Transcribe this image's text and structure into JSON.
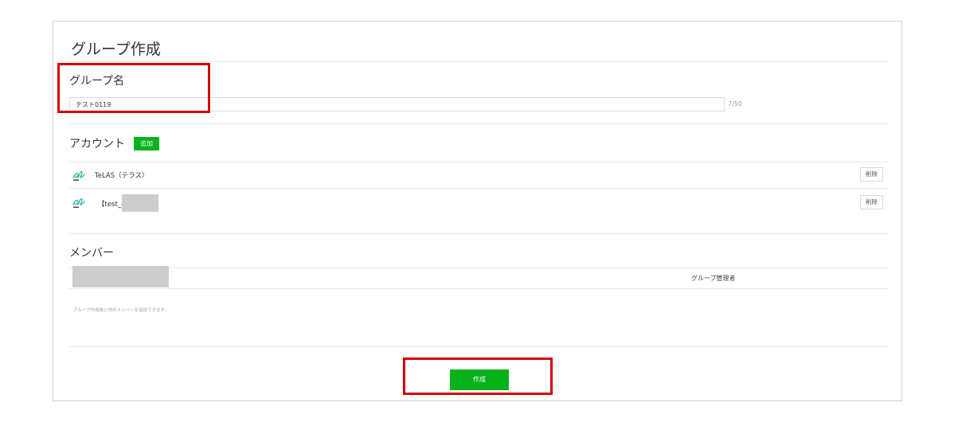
{
  "page": {
    "title": "グループ作成"
  },
  "group_name": {
    "label": "グループ名",
    "value": "テスト0119",
    "counter": "7/50"
  },
  "accounts": {
    "label": "アカウント",
    "add_label": "追加",
    "items": [
      {
        "name": "TeLAS（テラス）",
        "delete_label": "削除",
        "logo": "telas-logo-icon"
      },
      {
        "name": "【test_@",
        "delete_label": "削除",
        "logo": "telas-logo-icon"
      }
    ]
  },
  "members": {
    "label": "メンバー",
    "rows": [
      {
        "role": "グループ管理者"
      }
    ],
    "hint": "グループ作成後に他のメンバーを追加できます。"
  },
  "footer": {
    "create_label": "作成"
  },
  "colors": {
    "accent_green": "#06b21a",
    "highlight_red": "#d90000"
  }
}
